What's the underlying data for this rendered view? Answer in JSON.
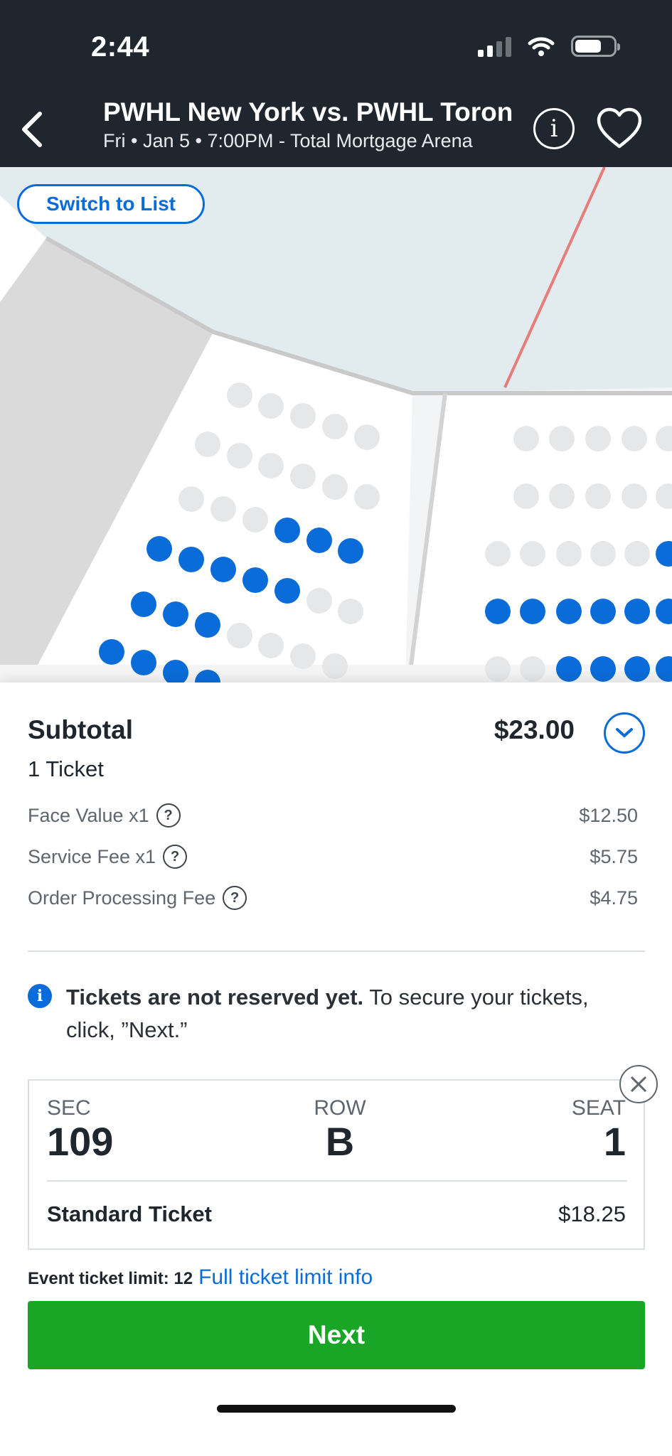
{
  "status_bar": {
    "time": "2:44",
    "icons": [
      "signal-icon",
      "wifi-icon",
      "battery-icon"
    ]
  },
  "header": {
    "title": "PWHL New York vs. PWHL Toron",
    "subtitle": "Fri • Jan 5 • 7:00PM - Total Mortgage Arena",
    "icons": [
      "back-icon",
      "info-icon",
      "heart-icon"
    ]
  },
  "map": {
    "switch_label": "Switch to List"
  },
  "summary": {
    "subtotal_label": "Subtotal",
    "subtotal_value": "$23.00",
    "ticket_count": "1 Ticket",
    "fees": [
      {
        "label": "Face Value x1",
        "value": "$12.50"
      },
      {
        "label": "Service Fee x1",
        "value": "$5.75"
      },
      {
        "label": "Order Processing Fee",
        "value": "$4.75"
      }
    ]
  },
  "notice": {
    "bold": "Tickets are not reserved yet.",
    "text": "To secure your tickets, click, ”Next.”"
  },
  "ticket": {
    "sec_label": "SEC",
    "sec": "109",
    "row_label": "ROW",
    "row": "B",
    "seat_label": "SEAT",
    "seat": "1",
    "type": "Standard Ticket",
    "price": "$18.25"
  },
  "limit": {
    "label": "Event ticket limit: 12",
    "link": "Full ticket limit info"
  },
  "next_label": "Next",
  "colors": {
    "header_bg": "#1f262d",
    "accent": "#0a6cd8",
    "next_green": "#19a626",
    "seat_available": "#0a6cd8",
    "seat_unavailable": "#e6e7e8"
  }
}
